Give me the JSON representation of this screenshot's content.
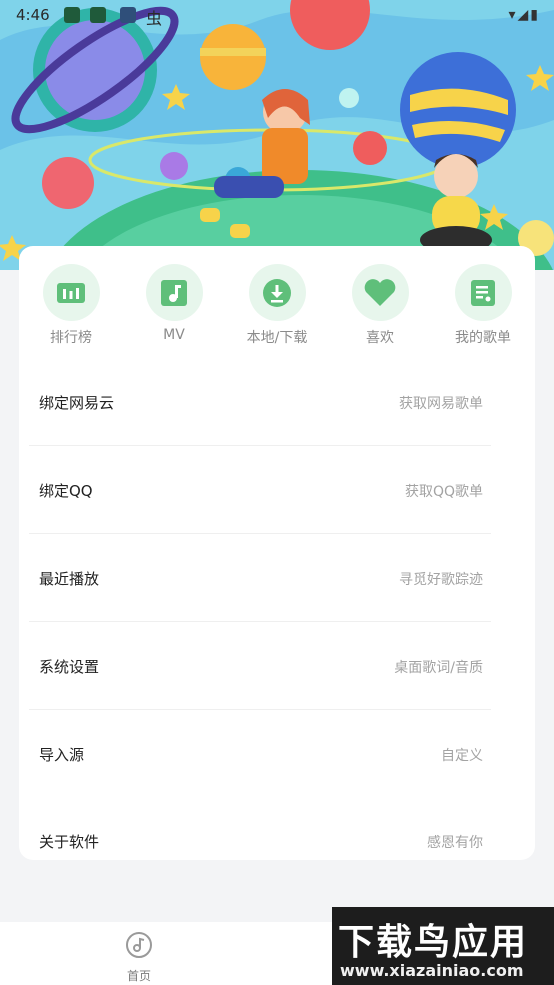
{
  "status_bar": {
    "time": "4:46",
    "extra_icon": "虫",
    "right_icons": "▾◢▮"
  },
  "quick_actions": [
    {
      "label": "排行榜",
      "icon": "chart-bars-icon"
    },
    {
      "label": "MV",
      "icon": "music-note-icon"
    },
    {
      "label": "本地/下载",
      "icon": "download-icon"
    },
    {
      "label": "喜欢",
      "icon": "heart-icon"
    },
    {
      "label": "我的歌单",
      "icon": "playlist-icon"
    }
  ],
  "menu": [
    {
      "label": "绑定网易云",
      "hint": "获取网易歌单"
    },
    {
      "label": "绑定QQ",
      "hint": "获取QQ歌单"
    },
    {
      "label": "最近播放",
      "hint": "寻觅好歌踪迹"
    },
    {
      "label": "系统设置",
      "hint": "桌面歌词/音质"
    },
    {
      "label": "导入源",
      "hint": "自定义"
    },
    {
      "label": "关于软件",
      "hint": "感恩有你"
    }
  ],
  "bottom_nav": {
    "home_label": "首页"
  },
  "watermark": {
    "title": "下载鸟应用",
    "url": "www.xiazainiao.com"
  },
  "colors": {
    "accent_green": "#5fbf7a",
    "accent_green_bg": "#e7f6ec",
    "header_sky": "#7fd3ea"
  }
}
